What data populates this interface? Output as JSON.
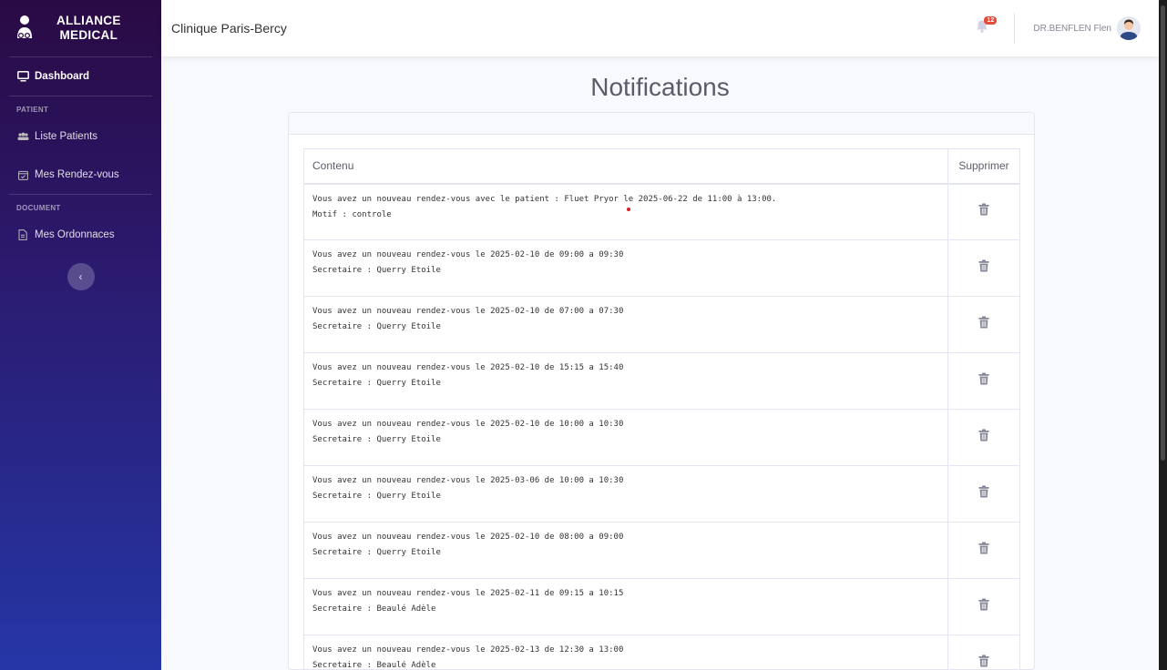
{
  "sidebar": {
    "brand_line1": "ALLIANCE",
    "brand_line2": "MEDICAL",
    "dashboard": "Dashboard",
    "heading_patient": "PATIENT",
    "liste_patients": "Liste Patients",
    "mes_rdv": "Mes Rendez-vous",
    "heading_document": "DOCUMENT",
    "mes_ordonnances": "Mes Ordonnaces",
    "toggle_icon": "chevron-left-icon"
  },
  "topbar": {
    "clinic": "Clinique Paris-Bercy",
    "notifications_count": "12",
    "username": "DR.BENFLEN Flen"
  },
  "page": {
    "title": "Notifications"
  },
  "table": {
    "col_content": "Contenu",
    "col_delete": "Supprimer",
    "rows": [
      {
        "line1": "Vous avez un nouveau rendez-vous avec le patient : Fluet Pryor le 2025-06-22 de 11:00 à 13:00.",
        "line2": "Motif : controle"
      },
      {
        "line1": "Vous avez un nouveau rendez-vous le 2025-02-10 de 09:00 a 09:30",
        "line2": "Secretaire : Querry Etoile"
      },
      {
        "line1": "Vous avez un nouveau rendez-vous le 2025-02-10 de 07:00 a 07:30",
        "line2": "Secretaire : Querry Etoile"
      },
      {
        "line1": "Vous avez un nouveau rendez-vous le 2025-02-10 de 15:15 a 15:40",
        "line2": "Secretaire : Querry Etoile"
      },
      {
        "line1": "Vous avez un nouveau rendez-vous le 2025-02-10 de 10:00 a 10:30",
        "line2": "Secretaire : Querry Etoile"
      },
      {
        "line1": "Vous avez un nouveau rendez-vous le 2025-03-06 de 10:00 a 10:30",
        "line2": "Secretaire : Querry Etoile"
      },
      {
        "line1": "Vous avez un nouveau rendez-vous le 2025-02-10 de 08:00 a 09:00",
        "line2": "Secretaire : Querry Etoile"
      },
      {
        "line1": "Vous avez un nouveau rendez-vous le 2025-02-11 de 09:15 a 10:15",
        "line2": "Secretaire : Beaulé Adèle"
      },
      {
        "line1": "Vous avez un nouveau rendez-vous le 2025-02-13 de 12:30 a 13:00",
        "line2": "Secretaire : Beaulé Adèle"
      }
    ]
  },
  "colors": {
    "sidebar_top": "#2a0a44",
    "sidebar_bottom": "#2536a6",
    "badge": "#e74a3b"
  }
}
